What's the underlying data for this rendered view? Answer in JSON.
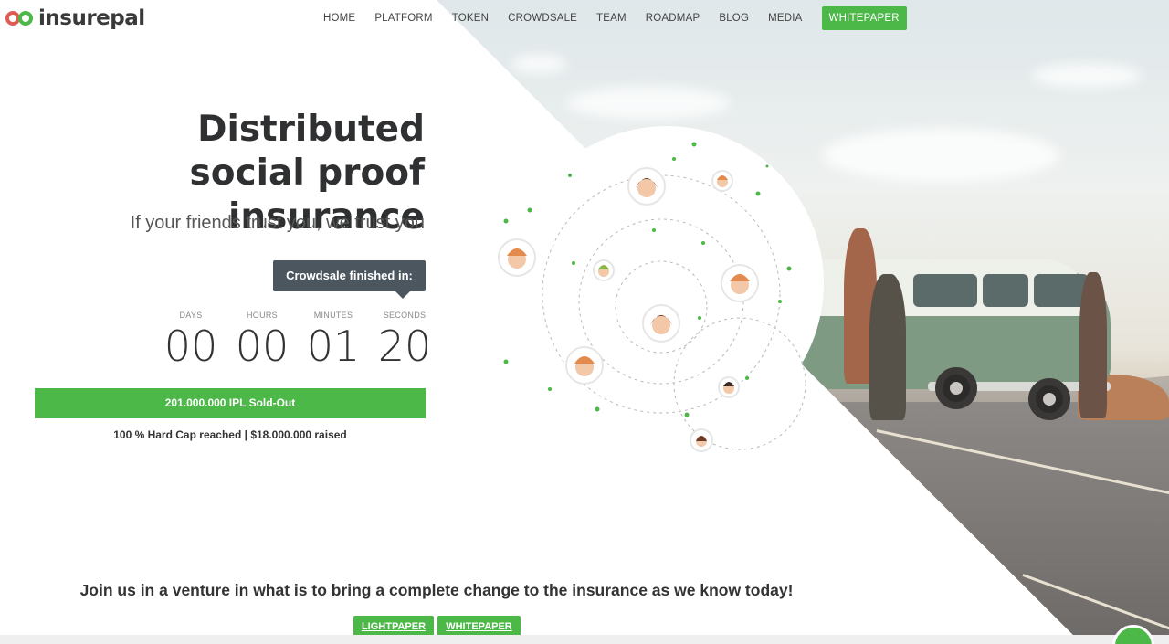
{
  "brand": {
    "logo_text": "insurepal"
  },
  "nav": {
    "items": [
      "HOME",
      "PLATFORM",
      "TOKEN",
      "CROWDSALE",
      "TEAM",
      "ROADMAP",
      "BLOG",
      "MEDIA"
    ],
    "cta": "WHITEPAPER"
  },
  "hero": {
    "title_line1": "Distributed",
    "title_line2": "social proof insurance",
    "subtitle": "If your friends trust you, we trust you"
  },
  "countdown": {
    "heading": "Crowdsale finished in:",
    "units": [
      {
        "label": "DAYS",
        "value": "00"
      },
      {
        "label": "HOURS",
        "value": "00"
      },
      {
        "label": "MINUTES",
        "value": "01"
      },
      {
        "label": "SECONDS",
        "value": "20"
      }
    ]
  },
  "sale": {
    "soldout_bar": "201.000.000 IPL Sold-Out",
    "hardcap": "100 % Hard Cap reached | $18.000.000 raised"
  },
  "bottom": {
    "join_text": "Join us in a venture in what is to bring a complete change to the insurance as we know today!",
    "lightpaper": "LIGHTPAPER",
    "whitepaper": "WHITEPAPER"
  },
  "colors": {
    "accent": "#4cb848",
    "dark_bubble": "#4c565e",
    "logo_red": "#e05d56"
  }
}
